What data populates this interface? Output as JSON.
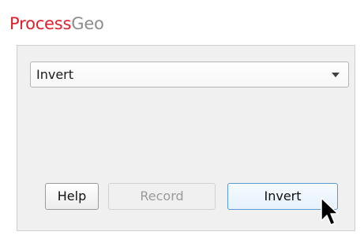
{
  "app": {
    "title_part1": "Process",
    "title_part2": "Geo"
  },
  "operation_select": {
    "selected": "Invert"
  },
  "buttons": {
    "help": "Help",
    "record": "Record",
    "invert": "Invert"
  },
  "colors": {
    "brand_red": "#e0202a",
    "brand_gray": "#8c8c8c",
    "focus_blue": "#5b9bd5"
  },
  "icons": {
    "dropdown": "chevron-down-icon",
    "cursor": "mouse-pointer-icon"
  }
}
